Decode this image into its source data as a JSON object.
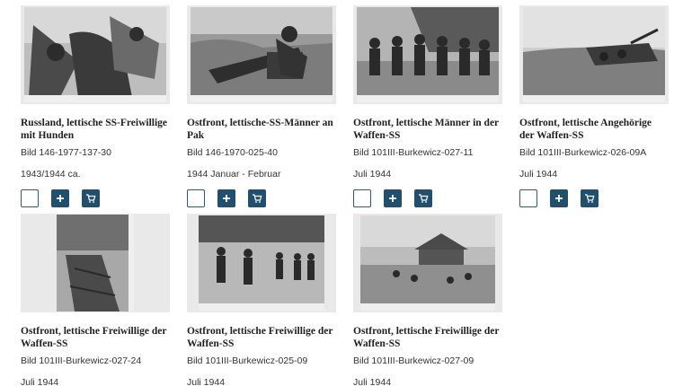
{
  "cards": [
    {
      "title": "Russland, lettische SS-Freiwillige mit Hunden",
      "signature": "Bild 146-1977-137-30",
      "date": "1943/1944 ca.",
      "has_actions": true
    },
    {
      "title": "Ostfront, lettische-SS-Männer an Pak",
      "signature": "Bild 146-1970-025-40",
      "date": "1944 Januar - Februar",
      "has_actions": true
    },
    {
      "title": "Ostfront, lettische Männer in der Waffen-SS",
      "signature": "Bild 101III-Burkewicz-027-11",
      "date": "Juli 1944",
      "has_actions": true
    },
    {
      "title": "Ostfront, lettische Angehörige der Waffen-SS",
      "signature": "Bild 101III-Burkewicz-026-09A",
      "date": "Juli 1944",
      "has_actions": true
    },
    {
      "title": "Ostfront, lettische Freiwillige der Waffen-SS",
      "signature": "Bild 101III-Burkewicz-027-24",
      "date": "Juli 1944",
      "has_actions": false
    },
    {
      "title": "Ostfront, lettische Freiwillige der Waffen-SS",
      "signature": "Bild 101III-Burkewicz-025-09",
      "date": "Juli 1944",
      "has_actions": false
    },
    {
      "title": "Ostfront, lettische Freiwillige der Waffen-SS",
      "signature": "Bild 101III-Burkewicz-027-09",
      "date": "Juli 1944",
      "has_actions": false
    }
  ],
  "icons": {
    "add": "plus-icon",
    "cart": "cart-icon",
    "select": "checkbox-icon"
  },
  "colors": {
    "button_primary": "#21506f",
    "button_border": "#2a5a7e",
    "thumb_bg": "#e9e9e9"
  }
}
